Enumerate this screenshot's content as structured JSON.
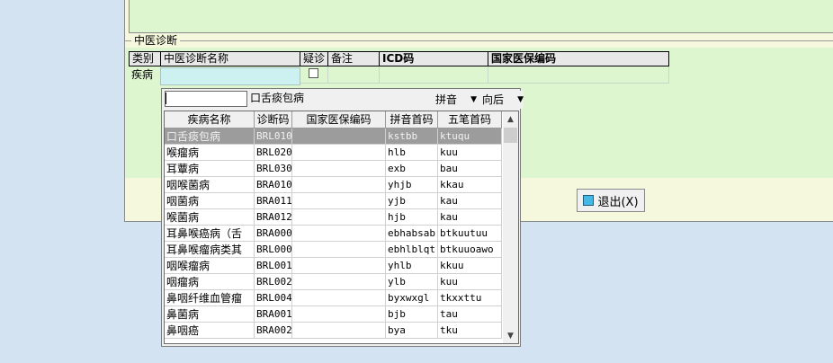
{
  "group": {
    "title": "中医诊断"
  },
  "grid": {
    "headers": [
      "类别",
      "中医诊断名称",
      "疑诊",
      "备注",
      "ICD码",
      "国家医保编码"
    ],
    "row_label": "疾病"
  },
  "exit_button": {
    "label": "退出(X)"
  },
  "popup": {
    "search_value": "口舌痰包病",
    "mode": "拼音",
    "match": "向后",
    "columns": [
      "疾病名称",
      "诊断码",
      "国家医保编码",
      "拼音首码",
      "五笔首码"
    ],
    "rows": [
      [
        "口舌痰包病",
        "BRL010",
        "",
        "kstbb",
        "ktuqu"
      ],
      [
        "喉瘤病",
        "BRL020",
        "",
        "hlb",
        "kuu"
      ],
      [
        "耳蕈病",
        "BRL030",
        "",
        "exb",
        "bau"
      ],
      [
        "咽喉菌病",
        "BRA010",
        "",
        "yhjb",
        "kkau"
      ],
      [
        "咽菌病",
        "BRA011",
        "",
        "yjb",
        "kau"
      ],
      [
        "喉菌病",
        "BRA012",
        "",
        "hjb",
        "kau"
      ],
      [
        "耳鼻喉癌病（舌",
        "BRA000",
        "",
        "ebhabsab",
        "btkuutuu"
      ],
      [
        "耳鼻喉瘤病类其",
        "BRL000",
        "",
        "ebhlblqt",
        "btkuuoawo"
      ],
      [
        "咽喉瘤病",
        "BRL001",
        "",
        "yhlb",
        "kkuu"
      ],
      [
        "咽瘤病",
        "BRL002",
        "",
        "ylb",
        "kuu"
      ],
      [
        "鼻咽纤维血管瘤",
        "BRL004",
        "",
        "byxwxgl",
        "tkxxttu"
      ],
      [
        "鼻菌病",
        "BRA001",
        "",
        "bjb",
        "tau"
      ],
      [
        "鼻咽癌",
        "BRA002",
        "",
        "bya",
        "tku"
      ]
    ]
  },
  "icons": {
    "exit": "exit-icon",
    "dropdown": "chevron-down-icon",
    "scroll_up": "chevron-up-icon",
    "scroll_down": "chevron-down-icon"
  },
  "colors": {
    "selected_row": "#9c9c9c",
    "input_highlight": "#cdf0f0",
    "panel_green": "#ddf6d0"
  }
}
